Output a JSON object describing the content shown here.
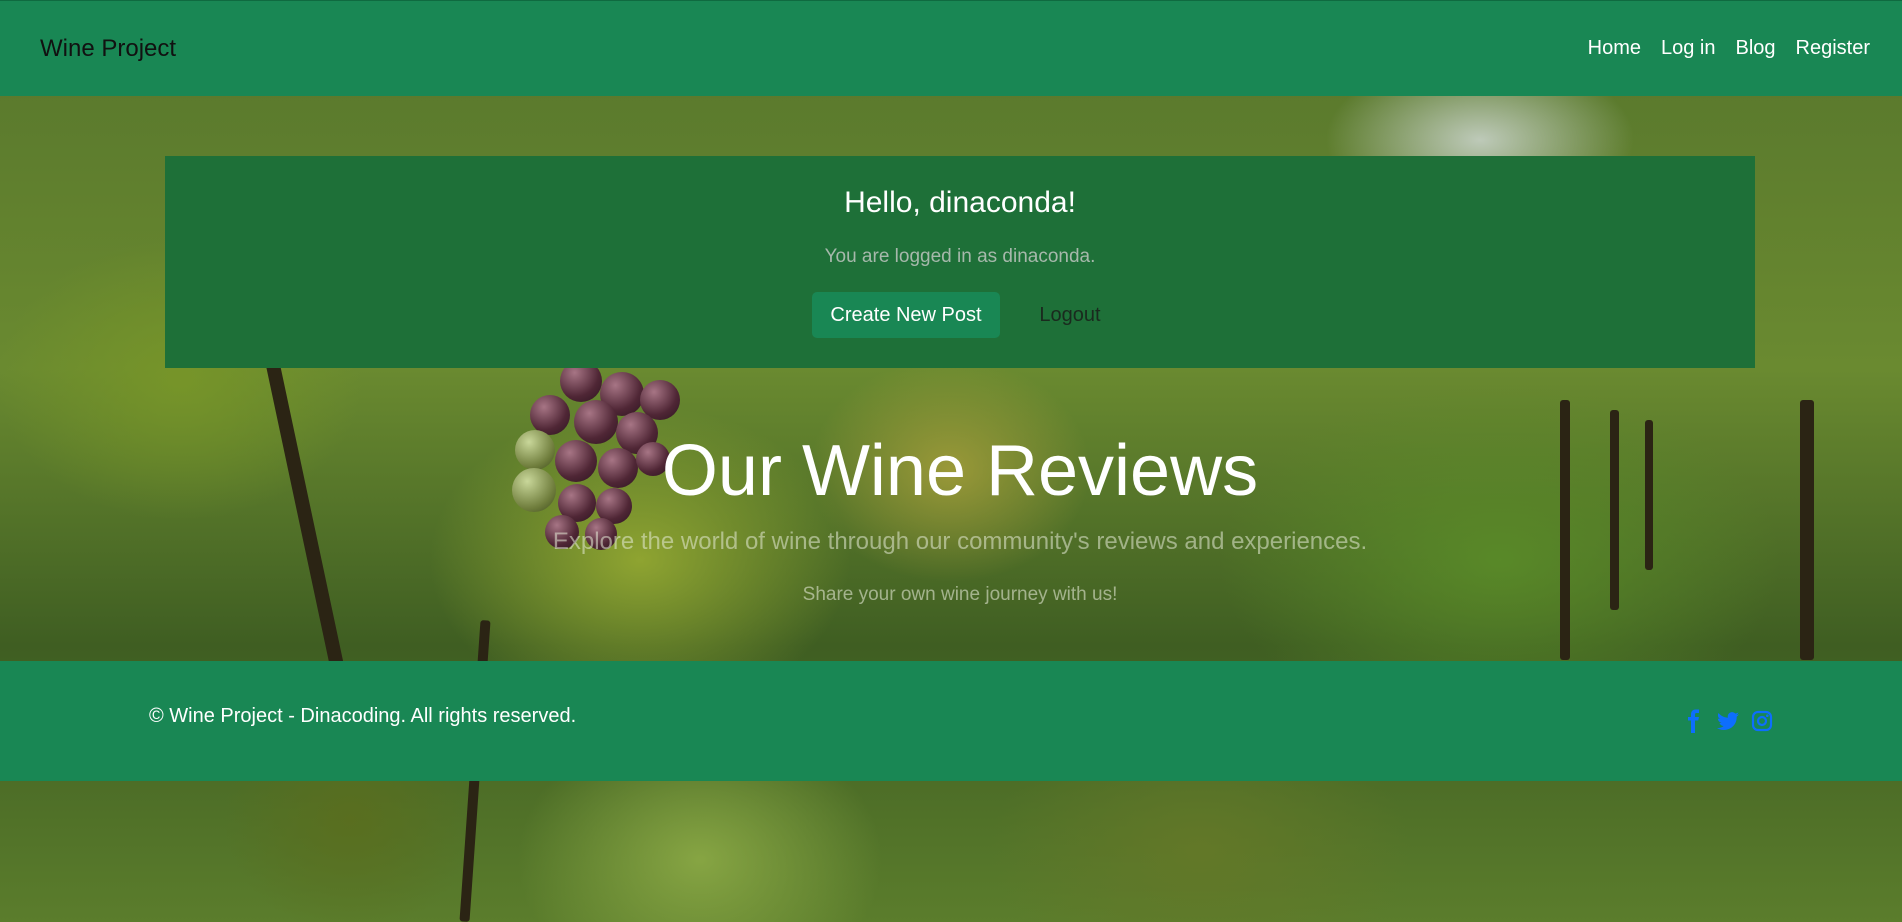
{
  "header": {
    "brand": "Wine Project",
    "nav": [
      "Home",
      "Log in",
      "Blog",
      "Register"
    ]
  },
  "welcome": {
    "greeting": "Hello, dinaconda!",
    "status": "You are logged in as dinaconda.",
    "create_label": "Create New Post",
    "logout_label": "Logout"
  },
  "hero": {
    "title": "Our Wine Reviews",
    "subtitle": "Explore the world of wine through our community's reviews and experiences.",
    "note": "Share your own wine journey with us!"
  },
  "footer": {
    "copyright": "© Wine Project - Dinacoding. All rights reserved.",
    "social_icons": [
      "facebook-icon",
      "twitter-icon",
      "instagram-icon"
    ]
  },
  "colors": {
    "brand_green": "#198754",
    "panel_green": "#1e7038",
    "social_blue": "#0d6efd"
  }
}
